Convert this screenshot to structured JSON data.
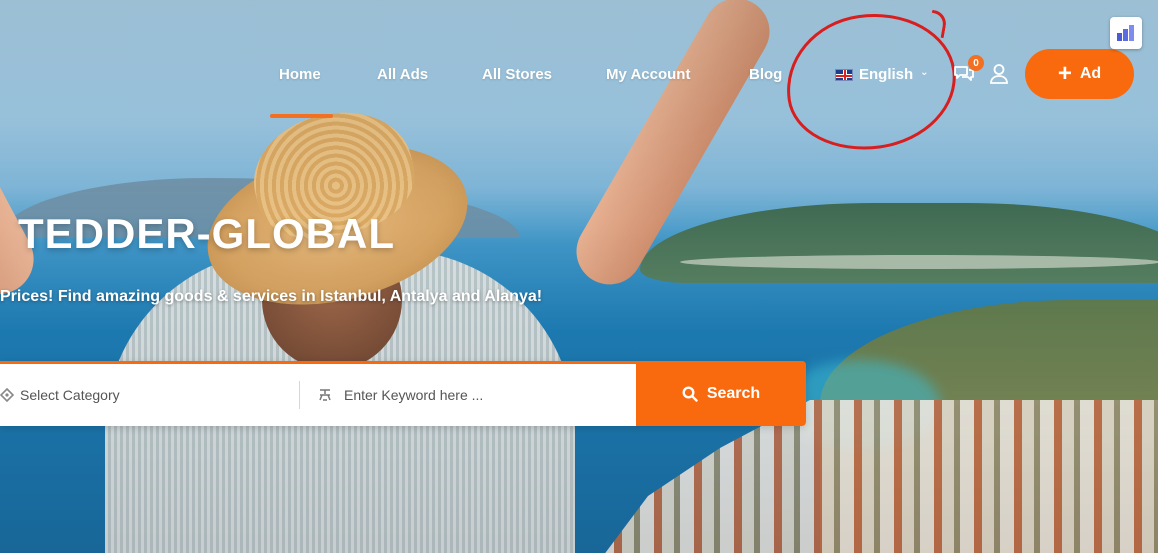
{
  "nav": {
    "items": [
      {
        "label": "Home",
        "active": true
      },
      {
        "label": "All Ads"
      },
      {
        "label": "All Stores"
      },
      {
        "label": "My Account"
      },
      {
        "label": "Blog"
      }
    ],
    "language": {
      "label": "English",
      "flag": "uk-flag-icon"
    },
    "chat_badge": "0",
    "ad_button": "Ad"
  },
  "hero": {
    "title": "TEDDER-GLOBAL",
    "tagline": "Prices! Find amazing goods & services in Istanbul, Antalya and Alanya!"
  },
  "search": {
    "category_label": "Select Category",
    "keyword_placeholder": "Enter Keyword here ...",
    "button_label": "Search"
  },
  "colors": {
    "accent": "#f86a0d",
    "annotation": "#d81e1e"
  }
}
